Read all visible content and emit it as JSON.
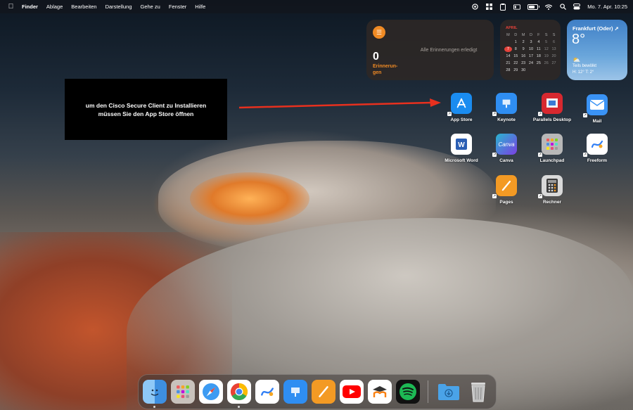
{
  "menubar": {
    "apple_icon": "apple-icon",
    "items": [
      "Finder",
      "Ablage",
      "Bearbeiten",
      "Darstellung",
      "Gehe zu",
      "Fenster",
      "Hilfe"
    ],
    "clock": "Mo. 7. Apr.  10:25",
    "battery_level": 0.75
  },
  "reminders": {
    "count": "0",
    "label": "Erinnerun-\ngen",
    "status": "Alle Erinnerungen erledigt",
    "accent": "#f08a24"
  },
  "calendar": {
    "month": "APRIL",
    "weekdays": [
      "M",
      "D",
      "M",
      "D",
      "F",
      "S",
      "S"
    ],
    "days": [
      "",
      "1",
      "2",
      "3",
      "4",
      "5",
      "6",
      "7",
      "8",
      "9",
      "10",
      "11",
      "12",
      "13",
      "14",
      "15",
      "16",
      "17",
      "18",
      "19",
      "20",
      "21",
      "22",
      "23",
      "24",
      "25",
      "26",
      "27",
      "28",
      "29",
      "30",
      "",
      "",
      "",
      ""
    ],
    "today": "7",
    "accent": "#e5423a"
  },
  "weather": {
    "city": "Frankfurt (Oder)",
    "temperature": "8°",
    "condition": "Teils bewölkt",
    "high_low": "H: 12° T: 2°"
  },
  "annotation": {
    "line1": "um den Cisco Secure Client zu Installieren",
    "line2": "müssen Sie den App Store öffnen",
    "arrow_color": "#e8301e"
  },
  "desktop_icons": [
    {
      "label": "App Store",
      "icon": "app-store-icon",
      "color": "#1a8cf0"
    },
    {
      "label": "Keynote",
      "icon": "keynote-icon",
      "color": "#2f8ef2"
    },
    {
      "label": "Parallels Desktop",
      "icon": "parallels-icon",
      "color": "#d7282f"
    },
    {
      "label": "Mail",
      "icon": "mail-icon",
      "color": "#3a93f5"
    },
    {
      "label": "Microsoft Word",
      "icon": "word-icon",
      "color": "#2b5fb4"
    },
    {
      "label": "Canva",
      "icon": "canva-icon",
      "color": "#29b5cf"
    },
    {
      "label": "Launchpad",
      "icon": "launchpad-icon",
      "color": "#b8b8b8"
    },
    {
      "label": "Freeform",
      "icon": "freeform-icon",
      "color": "#ffffff"
    },
    {
      "label": "Pages",
      "icon": "pages-icon",
      "color": "#f39a24"
    },
    {
      "label": "Rechner",
      "icon": "calculator-icon",
      "color": "#4a4a4a"
    }
  ],
  "dock": [
    {
      "name": "finder-icon",
      "color": "#5aa7f0",
      "running": true
    },
    {
      "name": "launchpad-icon",
      "color": "#c9c2bc",
      "running": false
    },
    {
      "name": "safari-icon",
      "color": "#3d9bf2",
      "running": false
    },
    {
      "name": "chrome-icon",
      "color": "#ffffff",
      "running": true
    },
    {
      "name": "freeform-icon",
      "color": "#ffffff",
      "running": false
    },
    {
      "name": "keynote-icon",
      "color": "#2f8ef2",
      "running": false
    },
    {
      "name": "pages-icon",
      "color": "#f39a24",
      "running": false
    },
    {
      "name": "youtube-icon",
      "color": "#ffffff",
      "running": false
    },
    {
      "name": "moodle-icon",
      "color": "#ffffff",
      "running": false
    },
    {
      "name": "spotify-icon",
      "color": "#111111",
      "running": false
    },
    {
      "name": "downloads-folder-icon",
      "color": "#4aa3e8",
      "running": false
    },
    {
      "name": "trash-icon",
      "color": "#c8c8c8",
      "running": false
    }
  ]
}
